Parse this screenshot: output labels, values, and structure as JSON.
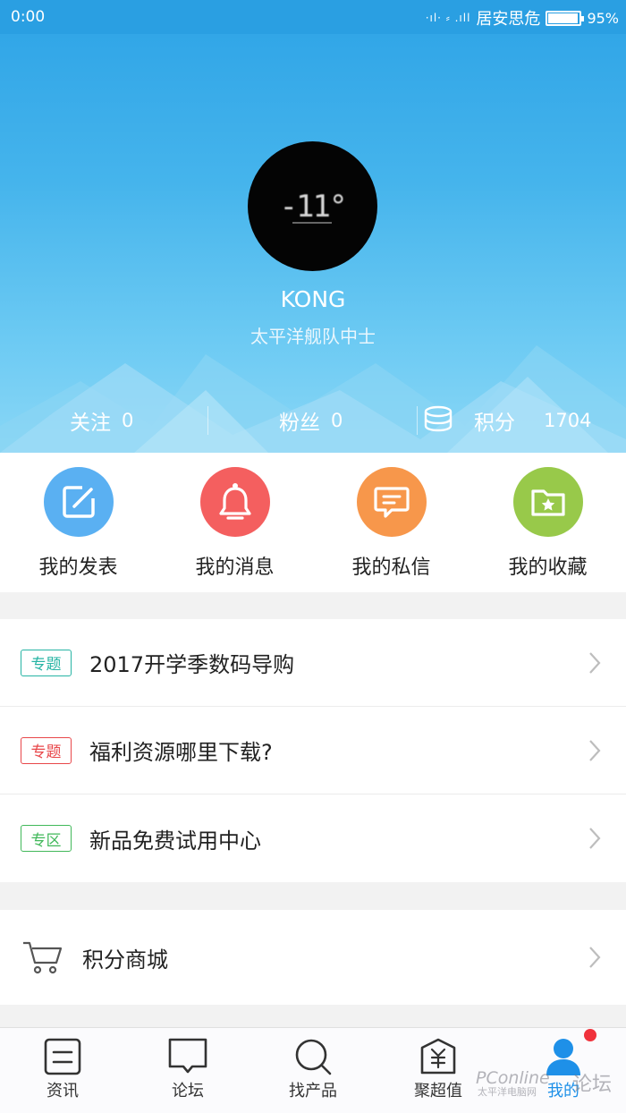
{
  "status_bar": {
    "time": "0:00",
    "carrier": "居安思危",
    "battery_percent_label": "95%",
    "battery_level": 0.95
  },
  "profile": {
    "avatar_text": "-11°",
    "username": "KONG",
    "rank": "太平洋舰队中士",
    "stats": {
      "follow_label": "关注",
      "follow_count": "0",
      "fans_label": "粉丝",
      "fans_count": "0",
      "points_label": "积分",
      "points_count": "1704"
    }
  },
  "quick_actions": [
    {
      "label": "我的发表",
      "icon": "edit-icon",
      "color": "#5ab0f2"
    },
    {
      "label": "我的消息",
      "icon": "bell-icon",
      "color": "#f45f5f"
    },
    {
      "label": "我的私信",
      "icon": "message-icon",
      "color": "#f7974b"
    },
    {
      "label": "我的收藏",
      "icon": "folder-star-icon",
      "color": "#98c94a"
    }
  ],
  "topics": [
    {
      "tag": "专题",
      "tag_color": "#27b4a4",
      "text": "2017开学季数码导购"
    },
    {
      "tag": "专题",
      "tag_color": "#e8474a",
      "text": "福利资源哪里下载?"
    },
    {
      "tag": "专区",
      "tag_color": "#41b85a",
      "text": "新品免费试用中心"
    }
  ],
  "shop": {
    "text": "积分商城",
    "icon": "cart-icon"
  },
  "nav": [
    {
      "label": "资讯",
      "icon": "news-icon"
    },
    {
      "label": "论坛",
      "icon": "forum-icon"
    },
    {
      "label": "找产品",
      "icon": "search-icon"
    },
    {
      "label": "聚超值",
      "icon": "deals-icon"
    },
    {
      "label": "我的",
      "icon": "user-icon",
      "active": true
    }
  ],
  "watermark": {
    "brand": "PConline",
    "forum": "论坛",
    "tagline": "太平洋电脑网"
  }
}
